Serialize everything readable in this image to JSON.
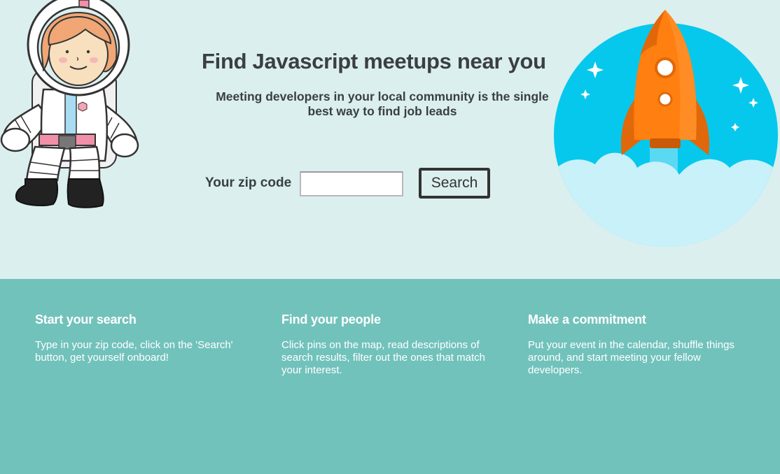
{
  "hero": {
    "title": "Find Javascript meetups near you",
    "subtitle": "Meeting developers in your local community is the single best way to find job leads"
  },
  "search": {
    "zip_label": "Your zip code",
    "zip_value": "",
    "zip_placeholder": "",
    "button_label": "Search"
  },
  "steps": [
    {
      "title": "Start your search",
      "text": "Type in your zip code, click on the 'Search' button, get yourself onboard!"
    },
    {
      "title": "Find your people",
      "text": "Click pins on the map, read descriptions of search results, filter out the ones that match your interest."
    },
    {
      "title": "Make a commitment",
      "text": "Put your event in the calendar, shuffle things around, and start meeting your fellow developers."
    }
  ],
  "colors": {
    "hero_bg": "#dbefee",
    "steps_bg": "#72c2bc",
    "text_dark": "#3a3f44",
    "rocket_orange": "#ff7f11",
    "sky_blue": "#06c8ec"
  },
  "icons": {
    "astronaut": "astronaut-illustration",
    "rocket": "rocket-illustration"
  }
}
